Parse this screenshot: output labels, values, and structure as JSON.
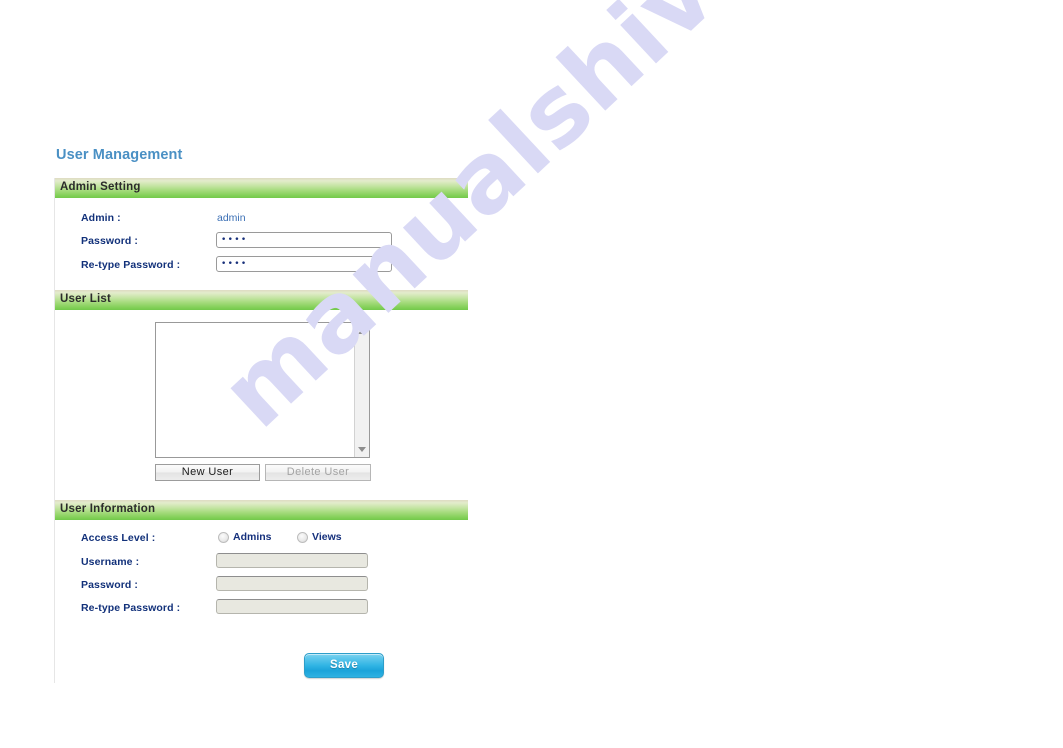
{
  "page": {
    "title": "User Management",
    "title_color": "#4a90c4"
  },
  "watermark": {
    "text": "manualshive.com",
    "color": "#d9d9f5"
  },
  "sections": {
    "admin_setting": {
      "header": "Admin Setting",
      "fields": {
        "admin_label": "Admin :",
        "admin_value": "admin",
        "password_label": "Password :",
        "password_value": "••••",
        "retype_label": "Re-type Password :",
        "retype_value": "••••"
      }
    },
    "user_list": {
      "header": "User List",
      "items": [],
      "scrollbar": {
        "up_icon": "scroll-up-arrow-icon",
        "down_icon": "scroll-down-arrow-icon"
      },
      "buttons": {
        "new_user": "New User",
        "delete_user": "Delete User",
        "delete_user_disabled": true
      }
    },
    "user_information": {
      "header": "User Information",
      "fields": {
        "access_level_label": "Access Level :",
        "radio_admins": "Admins",
        "radio_views": "Views",
        "radio_selected": "",
        "username_label": "Username :",
        "username_value": "",
        "password_label": "Password :",
        "password_value": "",
        "retype_label": "Re-type Password :",
        "retype_value": ""
      }
    }
  },
  "footer": {
    "save_label": "Save",
    "save_color": "#31b4e4"
  }
}
